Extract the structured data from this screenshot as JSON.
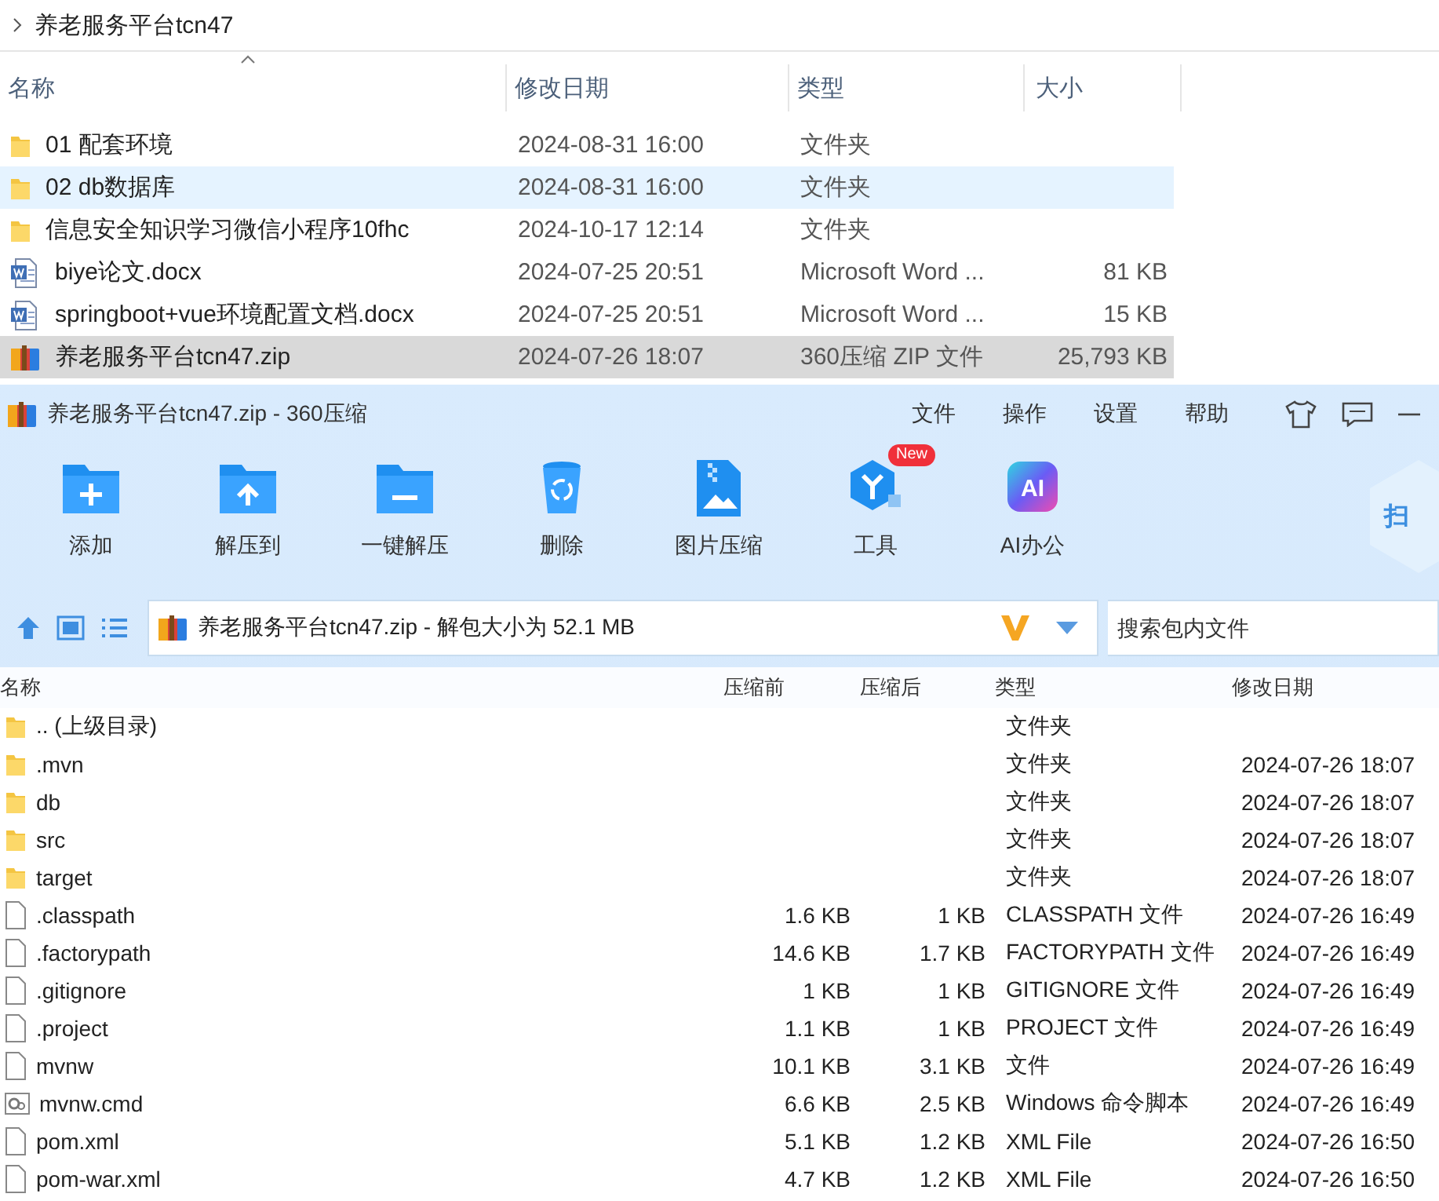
{
  "explorer": {
    "breadcrumb": "养老服务平台tcn47",
    "columns": [
      "名称",
      "修改日期",
      "类型",
      "大小"
    ],
    "rows": [
      {
        "kind": "folder",
        "name": "01 配套环境",
        "date": "2024-08-31 16:00",
        "type": "文件夹",
        "selected": false,
        "hovered": false
      },
      {
        "kind": "folder",
        "name": "02 db数据库",
        "date": "2024-08-31 16:00",
        "type": "文件夹",
        "selected": false,
        "hovered": true
      },
      {
        "kind": "folder",
        "name": "信息安全知识学习微信小程序10fhc",
        "date": "2024-10-17 12:14",
        "type": "文件夹",
        "selected": false,
        "hovered": false
      },
      {
        "kind": "word",
        "name": "biye论文.docx",
        "date": "2024-07-25 20:51",
        "type": "Microsoft Word ...",
        "size": "81 KB",
        "selected": false,
        "hovered": false
      },
      {
        "kind": "word",
        "name": "springboot+vue环境配置文档.docx",
        "date": "2024-07-25 20:51",
        "type": "Microsoft Word ...",
        "size": "15 KB",
        "selected": false,
        "hovered": false
      },
      {
        "kind": "zip",
        "name": "养老服务平台tcn47.zip",
        "date": "2024-07-26 18:07",
        "type": "360压缩 ZIP 文件",
        "size": "25,793 KB",
        "selected": true,
        "hovered": false
      }
    ]
  },
  "zip_window": {
    "title": "养老服务平台tcn47.zip - 360压缩",
    "menu": [
      "文件",
      "操作",
      "设置",
      "帮助"
    ],
    "tools": [
      {
        "kind": "add",
        "label": "添加"
      },
      {
        "kind": "extract",
        "label": "解压到"
      },
      {
        "kind": "onekey",
        "label": "一键解压"
      },
      {
        "kind": "delete",
        "label": "删除"
      },
      {
        "kind": "image",
        "label": "图片压缩"
      },
      {
        "kind": "tools",
        "label": "工具",
        "badge": "New"
      },
      {
        "kind": "ai",
        "label": "AI办公",
        "icon_text": "AI"
      }
    ],
    "side_badge": "扫",
    "address": "养老服务平台tcn47.zip - 解包大小为 52.1 MB",
    "search": {
      "placeholder": "搜索包内文件"
    },
    "columns": [
      "名称",
      "压缩前",
      "压缩后",
      "类型",
      "修改日期"
    ],
    "rows": [
      {
        "kind": "folder",
        "name": ".. (上级目录)",
        "type": "文件夹"
      },
      {
        "kind": "folder",
        "name": ".mvn",
        "type": "文件夹",
        "date": "2024-07-26 18:07"
      },
      {
        "kind": "folder",
        "name": "db",
        "type": "文件夹",
        "date": "2024-07-26 18:07"
      },
      {
        "kind": "folder",
        "name": "src",
        "type": "文件夹",
        "date": "2024-07-26 18:07"
      },
      {
        "kind": "folder",
        "name": "target",
        "type": "文件夹",
        "date": "2024-07-26 18:07"
      },
      {
        "kind": "file",
        "name": ".classpath",
        "before": "1.6 KB",
        "after": "1 KB",
        "type": "CLASSPATH 文件",
        "date": "2024-07-26 16:49"
      },
      {
        "kind": "file",
        "name": ".factorypath",
        "before": "14.6 KB",
        "after": "1.7 KB",
        "type": "FACTORYPATH 文件",
        "date": "2024-07-26 16:49"
      },
      {
        "kind": "file",
        "name": ".gitignore",
        "before": "1 KB",
        "after": "1 KB",
        "type": "GITIGNORE 文件",
        "date": "2024-07-26 16:49"
      },
      {
        "kind": "file",
        "name": ".project",
        "before": "1.1 KB",
        "after": "1 KB",
        "type": "PROJECT 文件",
        "date": "2024-07-26 16:49"
      },
      {
        "kind": "file",
        "name": "mvnw",
        "before": "10.1 KB",
        "after": "3.1 KB",
        "type": "文件",
        "date": "2024-07-26 16:49"
      },
      {
        "kind": "cmd",
        "name": "mvnw.cmd",
        "before": "6.6 KB",
        "after": "2.5 KB",
        "type": "Windows 命令脚本",
        "date": "2024-07-26 16:49"
      },
      {
        "kind": "file",
        "name": "pom.xml",
        "before": "5.1 KB",
        "after": "1.2 KB",
        "type": "XML File",
        "date": "2024-07-26 16:50"
      },
      {
        "kind": "file",
        "name": "pom-war.xml",
        "before": "4.7 KB",
        "after": "1.2 KB",
        "type": "XML File",
        "date": "2024-07-26 16:50"
      }
    ]
  }
}
